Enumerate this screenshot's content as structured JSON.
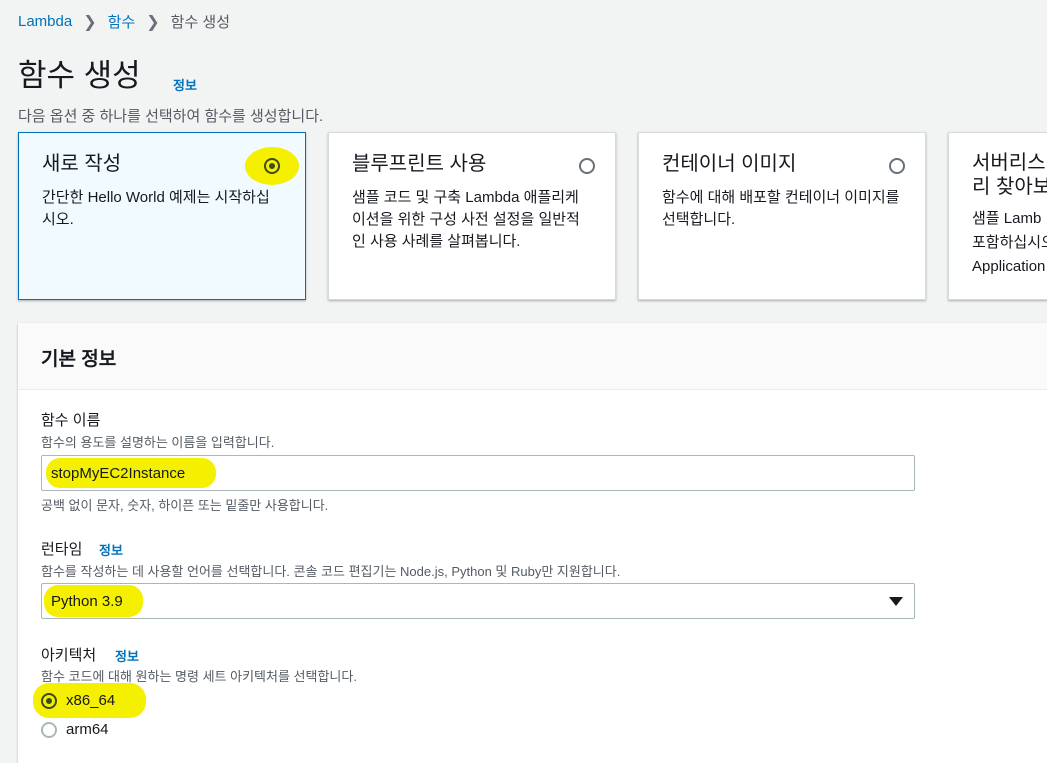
{
  "breadcrumb": {
    "items": [
      "Lambda",
      "함수",
      "함수 생성"
    ]
  },
  "page": {
    "title": "함수 생성",
    "info": "정보",
    "description": "다음 옵션 중 하나를 선택하여 함수를 생성합니다."
  },
  "options": [
    {
      "title": "새로 작성",
      "desc": "간단한 Hello World 예제는 시작하십시오.",
      "selected": true
    },
    {
      "title": "블루프린트 사용",
      "desc": "샘플 코드 및 구축 Lambda 애플리케이션을 위한 구성 사전 설정을 일반적인 사용 사례를 살펴봅니다.",
      "selected": false
    },
    {
      "title": "컨테이너 이미지",
      "desc": "함수에 대해 배포할 컨테이너 이미지를 선택합니다.",
      "selected": false
    },
    {
      "title": "서버리스\n리 찾아보",
      "desc": "샘플 Lamb\n포함하십시오\nApplication",
      "selected": false
    }
  ],
  "basic": {
    "header": "기본 정보",
    "function_name": {
      "label": "함수 이름",
      "desc": "함수의 용도를 설명하는 이름을 입력합니다.",
      "value": "stopMyEC2Instance",
      "hint": "공백 없이 문자, 숫자, 하이픈 또는 밑줄만 사용합니다."
    },
    "runtime": {
      "label": "런타임",
      "info": "정보",
      "desc": "함수를 작성하는 데 사용할 언어를 선택합니다. 콘솔 코드 편집기는 Node.js, Python 및 Ruby만 지원합니다.",
      "value": "Python 3.9"
    },
    "architecture": {
      "label": "아키텍처",
      "info": "정보",
      "desc": "함수 코드에 대해 원하는 명령 세트 아키텍처를 선택합니다.",
      "options": [
        "x86_64",
        "arm64"
      ],
      "selected": "x86_64"
    }
  },
  "colors": {
    "link": "#0073bb",
    "highlight": "#f5f000",
    "selected_card_bg": "#f1faff"
  }
}
